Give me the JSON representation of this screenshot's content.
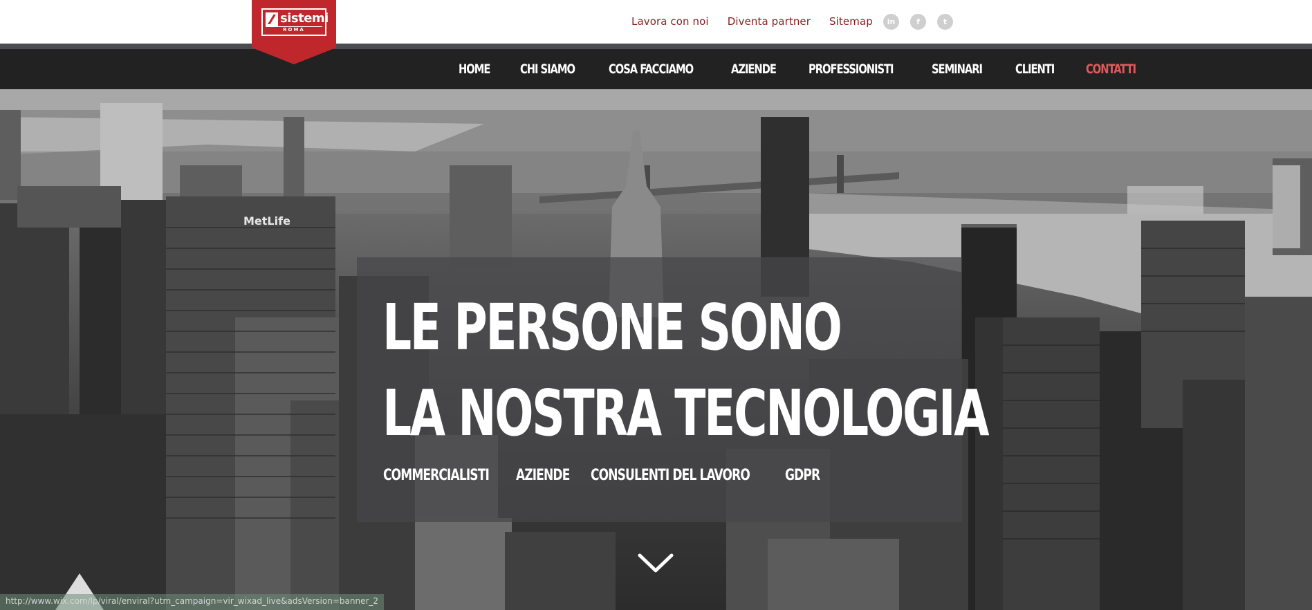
{
  "brand": {
    "logo_text": "sistemi",
    "logo_subtext": "ROMA",
    "accent_color": "#c0272d"
  },
  "top_links": [
    {
      "label": "Lavora con noi"
    },
    {
      "label": "Diventa partner"
    },
    {
      "label": "Sitemap"
    }
  ],
  "social": [
    {
      "icon": "linkedin-icon",
      "glyph": "in"
    },
    {
      "icon": "facebook-icon",
      "glyph": "f"
    },
    {
      "icon": "twitter-icon",
      "glyph": "t"
    }
  ],
  "nav": {
    "items": [
      {
        "label": "HOME"
      },
      {
        "label": "CHI SIAMO"
      },
      {
        "label": "COSA FACCIAMO"
      },
      {
        "label": "AZIENDE"
      },
      {
        "label": "PROFESSIONISTI"
      },
      {
        "label": "SEMINARI"
      },
      {
        "label": "CLIENTI"
      },
      {
        "label": "CONTATTI",
        "active": true
      }
    ],
    "active_color": "#e05a5d"
  },
  "hero": {
    "headline_line1": "LE PERSONE SONO",
    "headline_line2": "LA NOSTRA TECNOLOGIA",
    "categories": [
      {
        "label": "COMMERCIALISTI"
      },
      {
        "label": "AZIENDE"
      },
      {
        "label": "CONSULENTI DEL LAVORO"
      },
      {
        "label": "GDPR"
      }
    ],
    "building_sign": "MetLife",
    "scroll_icon": "chevron-down-icon"
  },
  "status_bar": {
    "url": "http://www.wix.com/lp/viral/enviral?utm_campaign=vir_wixad_live&adsVersion=banner_2"
  }
}
